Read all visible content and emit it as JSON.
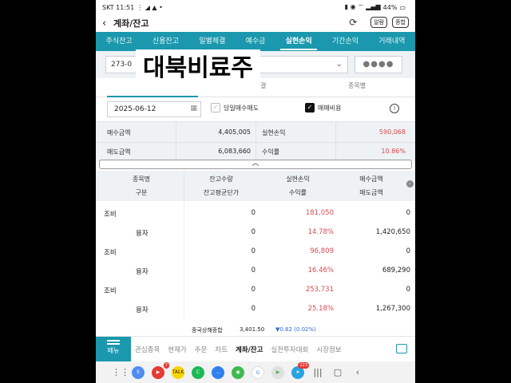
{
  "status": {
    "left": "SKT 11:51",
    "battery": "44%"
  },
  "title": "계좌/잔고",
  "header_buttons": [
    "알람",
    "종합"
  ],
  "tabs": [
    "주식잔고",
    "신용잔고",
    "일별체결",
    "예수금",
    "실현손익",
    "기간손익",
    "거래내역"
  ],
  "active_tab": 4,
  "account": {
    "number": "273-0",
    "password_mask": "●●●●"
  },
  "overlay_text": "대북비료주",
  "subtabs": {
    "left": "",
    "middle": "결",
    "right": "종목별"
  },
  "filter": {
    "date": "2025-06-12",
    "opt1": "당일매수매도",
    "opt2": "매매비용"
  },
  "summary": {
    "buy_label": "매수금액",
    "buy_value": "4,405,005",
    "sell_label": "매도금액",
    "sell_value": "6,083,660",
    "pl_label": "실현손익",
    "pl_value": "590,068",
    "rate_label": "수익률",
    "rate_value": "10.86%"
  },
  "table": {
    "headers_row1": [
      "종목명",
      "잔고수량",
      "실현손익",
      "매수금액"
    ],
    "headers_row2": [
      "구분",
      "잔고평균단가",
      "수익률",
      "매도금액"
    ],
    "rows": [
      {
        "name": "조비",
        "qty": "0",
        "pl": "181,050",
        "buy": "0",
        "type": "융자",
        "avg": "0",
        "rate": "14.78%",
        "sell": "1,420,650"
      },
      {
        "name": "조비",
        "qty": "0",
        "pl": "96,809",
        "buy": "0",
        "type": "융자",
        "avg": "0",
        "rate": "16.46%",
        "sell": "689,290"
      },
      {
        "name": "조비",
        "qty": "0",
        "pl": "253,731",
        "buy": "0",
        "type": "융자",
        "avg": "0",
        "rate": "25.18%",
        "sell": "1,267,300"
      }
    ]
  },
  "ticker": {
    "name": "중국상해종합",
    "value": "3,401.50",
    "change": "▼0.82 (0.02%)"
  },
  "bottom_nav": {
    "menu": "메뉴",
    "items": [
      "관심종목",
      "현재가",
      "주문",
      "차트",
      "계좌/잔고",
      "실전투자대회",
      "시장정보"
    ],
    "active": 4
  },
  "colors": {
    "accent": "#1b98ad",
    "profit": "#d94a50",
    "down": "#2f6bd8"
  }
}
